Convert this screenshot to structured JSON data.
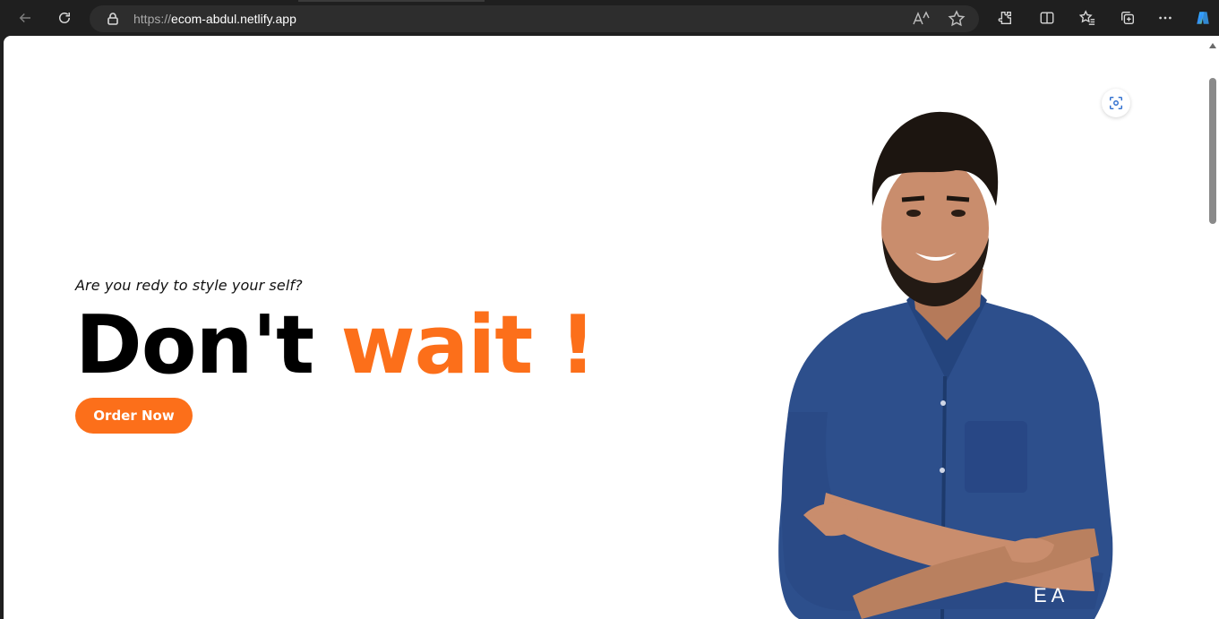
{
  "browser": {
    "url_prefix": "https://",
    "url_domain": "ecom-abdul.netlify.app",
    "icons": [
      "back-icon",
      "refresh-icon",
      "lock-icon",
      "read-aloud-icon",
      "favorite-star-icon",
      "extensions-icon",
      "split-screen-icon",
      "favorites-icon",
      "collections-icon",
      "more-icon",
      "copilot-icon"
    ]
  },
  "hero": {
    "subline": "Are you redy to style your self?",
    "headline_main": "Don't ",
    "headline_accent": "wait !",
    "cta_label": "Order Now",
    "corner_text": "E  A"
  },
  "colors": {
    "accent": "#fc6f1a",
    "shirt": "#2d4f8c",
    "skin": "#c98d6d"
  }
}
